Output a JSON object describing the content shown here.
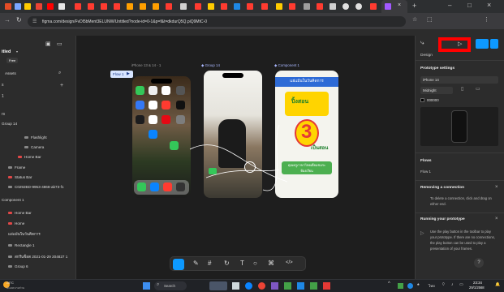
{
  "browser": {
    "url": "figma.com/design/FvDl5bMent3ELUNW/Untitled?node-id=0-1&p=f&t=dkdurQ5Q.piQ9MtC-0",
    "window_controls": [
      "–",
      "□",
      "×"
    ]
  },
  "left_panel": {
    "file_title": "itled",
    "plan_badge": "Free",
    "page_label": "Assets",
    "layers": [
      {
        "label": "Group 14",
        "indent": 0
      },
      {
        "label": "Flashlight",
        "indent": 3
      },
      {
        "label": "Camera",
        "indent": 3
      },
      {
        "label": "Home Bar",
        "indent": 2
      },
      {
        "label": "Frame",
        "indent": 1
      },
      {
        "label": "Status Bar",
        "indent": 1
      },
      {
        "label": "C0292BD-9953-4868-ab73-f1",
        "indent": 1
      },
      {
        "label": "Component 1",
        "indent": 0
      },
      {
        "label": "Home Bar",
        "indent": 1
      },
      {
        "label": "Home",
        "indent": 1
      },
      {
        "label": "แย่แม้นในวันคิดการ",
        "indent": 1
      },
      {
        "label": "Rectangle 1",
        "indent": 1
      },
      {
        "label": "สกรีนช็อต 2021-01-29 204827 1",
        "indent": 1
      },
      {
        "label": "Group 6",
        "indent": 1
      }
    ]
  },
  "canvas": {
    "frame_labels": [
      "iPhone 13 & 14 - 1",
      "◆ Group 14",
      "◆ Component 1"
    ],
    "flow_label": "Flow 1",
    "card_header": "แย่แม้นในวันคิดการ",
    "card_big_number": "3",
    "card_badge_top": "ปิ้งสอน",
    "card_badge_bottom": "เป็นสอน",
    "card_footer": "คุณครูภาษาไทยเยี่ยมชมระห้องเรียน",
    "toolbar_icons": [
      "cursor-icon",
      "pen-icon",
      "frame-icon",
      "comment-icon",
      "text-icon",
      "shape-icon",
      "component-icon",
      "code-icon"
    ]
  },
  "right_panel": {
    "tab_design": "Design",
    "section_prototype": "Prototype settings",
    "device": "iPhone 14",
    "model": "Midnight",
    "color_hex": "000000",
    "flows_title": "Flows",
    "flow_item": "Flow 1",
    "removing_title": "Removing a connection",
    "removing_text": "To delete a connection, click and drag on either end.",
    "running_title": "Running your prototype",
    "running_text": "Use the play button in the toolbar to play your prototype. If there are no connections, the play button can be used to play a presentation of your frames."
  },
  "taskbar": {
    "weather_temp": "28°C",
    "weather_text": "มีแดดบางส่วน",
    "search_placeholder": "Search",
    "lang": "ไทย",
    "time": "23:34",
    "date": "29/1/2568"
  }
}
